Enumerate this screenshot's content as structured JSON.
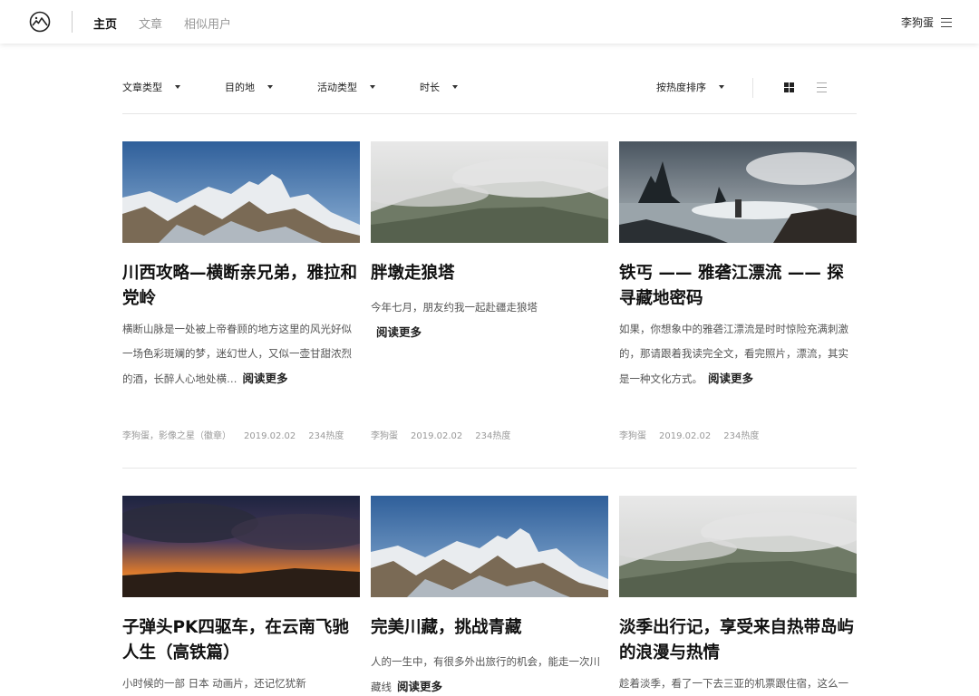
{
  "nav": {
    "items": [
      "主页",
      "文章",
      "相似用户"
    ],
    "active_index": 0,
    "user_name": "李狗蛋"
  },
  "filters": {
    "items": [
      "文章类型",
      "目的地",
      "活动类型",
      "时长"
    ],
    "sort_label": "按热度排序"
  },
  "read_more": "阅读更多",
  "cards": [
    {
      "title": "川西攻略—横断亲兄弟，雅拉和党岭",
      "excerpt": "横断山脉是一处被上帝眷顾的地方这里的风光好似一场色彩斑斓的梦，迷幻世人，又似一壶甘甜浓烈的酒，长醉人心地处横…",
      "author": "李狗蛋，影像之星（徽章）",
      "date": "2019.02.02",
      "heat": "234热度"
    },
    {
      "title": "胖墩走狼塔",
      "excerpt": "今年七月，朋友约我一起赴疆走狼塔",
      "author": "李狗蛋",
      "date": "2019.02.02",
      "heat": "234热度"
    },
    {
      "title": "铁丐 —— 雅砻江漂流 —— 探寻藏地密码",
      "excerpt": "如果，你想象中的雅砻江漂流是时时惊险充满刺激的，那请跟着我读完全文，看完照片，漂流，其实是一种文化方式。",
      "author": "李狗蛋",
      "date": "2019.02.02",
      "heat": "234热度"
    },
    {
      "title": "子弹头PK四驱车，在云南飞驰人生（高铁篇）",
      "excerpt": "小时候的一部 日本 动画片，还记忆犹新"
    },
    {
      "title": "完美川藏，挑战青藏",
      "excerpt": "人的一生中，有很多外出旅行的机会，能走一次川藏线"
    },
    {
      "title": "淡季出行记，享受来自热带岛屿的浪漫与热情",
      "excerpt": "趁着淡季，看了一下去三亚的机票跟住宿，这么一"
    }
  ]
}
